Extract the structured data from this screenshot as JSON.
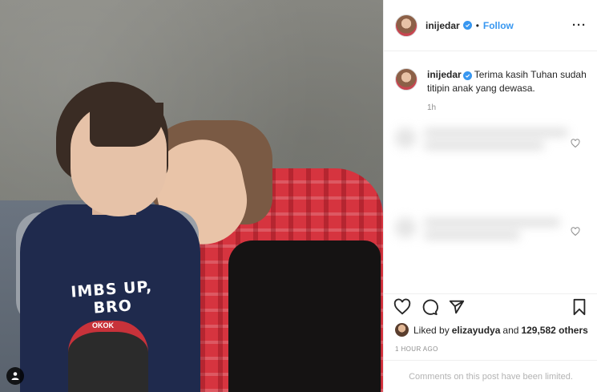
{
  "header": {
    "username": "inijedar",
    "separator": "•",
    "follow_label": "Follow",
    "more_label": "···"
  },
  "caption": {
    "username": "inijedar",
    "text": "Terima kasih Tuhan sudah titipin anak yang dewasa.",
    "time": "1h"
  },
  "photo": {
    "shirt_text": "IMBS UP, BRO",
    "shirt_badge": "OKOK"
  },
  "likes": {
    "prefix": "Liked by",
    "user": "elizayudya",
    "joiner": "and",
    "count": "129,582 others"
  },
  "timestamp": "1 HOUR AGO",
  "comments_limited": "Comments on this post have been limited.",
  "icons": {
    "verified": "verified-badge-icon",
    "like": "heart-icon",
    "comment": "comment-bubble-icon",
    "share": "share-icon",
    "save": "bookmark-icon",
    "tag": "user-tag-icon"
  },
  "colors": {
    "link_blue": "#3897f0",
    "text": "#262626",
    "muted": "#8e8e8e",
    "border": "#efefef"
  }
}
